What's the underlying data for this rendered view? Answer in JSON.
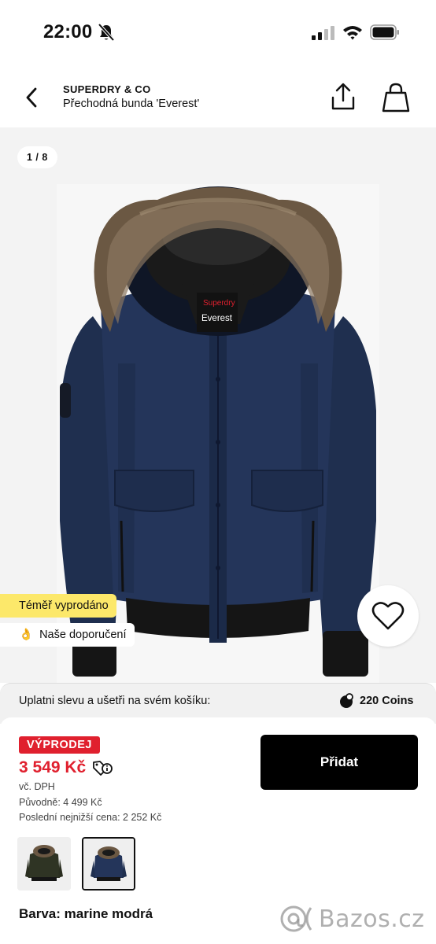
{
  "status_bar": {
    "time": "22:00",
    "icons": [
      "bell-off-icon",
      "signal-icon",
      "wifi-icon",
      "battery-icon"
    ]
  },
  "header": {
    "brand": "SUPERDRY & CO",
    "title": "Přechodná bunda 'Everest'",
    "icons": [
      "chevron-left-icon",
      "share-icon",
      "shopping-bag-icon"
    ]
  },
  "gallery": {
    "page_indicator": "1 / 8",
    "tag_sold_out": "Téměř vyprodáno",
    "tag_recommend": "Naše doporučení",
    "tag_recommend_emoji": "👌",
    "jacket_logo": "Superdry Everest"
  },
  "coins": {
    "text": "Uplatni slevu a ušetři na svém košíku:",
    "value": "220 Coins"
  },
  "product": {
    "sale_badge": "VÝPRODEJ",
    "price": "3 549 Kč",
    "vat": "vč. DPH",
    "original_price": "Původně: 4 499 Kč",
    "lowest_price": "Poslední nejnižší cena:  2 252 Kč",
    "add_button": "Přidat",
    "color_label": "Barva:",
    "color_value": "marine modrá"
  },
  "watermark": "Bazos.cz",
  "colors": {
    "sale_red": "#e0202e",
    "sold_out_yellow": "#fce86a",
    "jacket_navy": "#1f2f4f"
  }
}
